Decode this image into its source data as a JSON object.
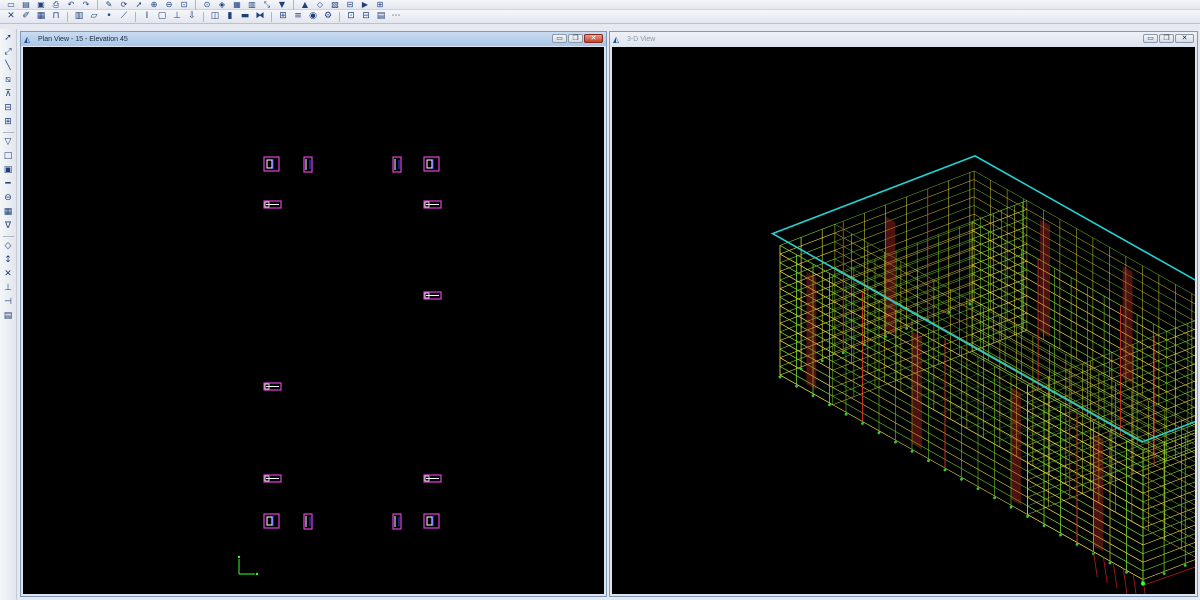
{
  "toolbar_top": {
    "icons": [
      "new-icon",
      "open-icon",
      "save-icon",
      "print-icon",
      "undo-icon",
      "redo-icon",
      "edit-icon",
      "refresh-icon",
      "pointer-icon",
      "zoom-in-icon",
      "zoom-out-icon",
      "zoom-window-icon",
      "zoom-previous-icon",
      "view-3d-icon",
      "plan-view-icon",
      "elevation-view-icon",
      "rubber-band-icon",
      "move-down-icon",
      "move-up-icon",
      "perspective-icon",
      "display-options-icon",
      "section-cut-icon",
      "run-analysis-icon",
      "lock-icon"
    ]
  },
  "toolbar_second": {
    "icons": [
      "select-icon",
      "draw-icon",
      "grid-icon",
      "frame-icon",
      "wall-icon",
      "area-icon",
      "joint-icon",
      "brace-icon",
      "section-icon",
      "shell-icon",
      "restraint-icon",
      "load-icon",
      "diaphragm-icon",
      "pier-icon",
      "spandrel-icon",
      "link-icon",
      "group-icon",
      "assign-icon",
      "display-icon",
      "design-icon",
      "detail-icon",
      "output-icon",
      "table-icon",
      "options-icon"
    ]
  },
  "left_toolbar": {
    "icons": [
      "pointer-icon",
      "reshape-icon",
      "draw-line-icon",
      "draw-brace-icon",
      "draw-column-icon",
      "draw-beam-icon",
      "draw-secondary-beam-icon",
      "draw-area-icon",
      "draw-rectangle-icon",
      "draw-wall-icon",
      "draw-opening-icon",
      "draw-link-icon",
      "draw-section-icon",
      "draw-dimension-icon",
      "snap-joint-icon",
      "snap-midpoint-icon",
      "snap-intersection-icon",
      "snap-perpendicular-icon",
      "snap-line-icon",
      "snap-grid-icon"
    ]
  },
  "windows": {
    "plan": {
      "title": "Plan View - 15 - Elevation 45",
      "icon": "structure-view-icon",
      "minimize": "▭",
      "restore": "❐",
      "close": "✕"
    },
    "view3d": {
      "title": "3-D View",
      "icon": "structure-view-icon",
      "minimize": "▭",
      "restore": "❐",
      "close": "✕"
    }
  },
  "colors": {
    "canvas_background": "#000000",
    "plan_wall_pink": "#e040e0",
    "plan_wall_white": "#ffffff",
    "plan_wall_blue": "#3a3aff",
    "model_frame_green": "#7ad629",
    "model_frame_yellow": "#e6e43a",
    "model_column_red": "#d9342a",
    "model_outline_cyan": "#22d3d3",
    "support_green": "#2ecc40",
    "axis_green": "#33ff33",
    "load_line_red": "#b31d1d"
  }
}
